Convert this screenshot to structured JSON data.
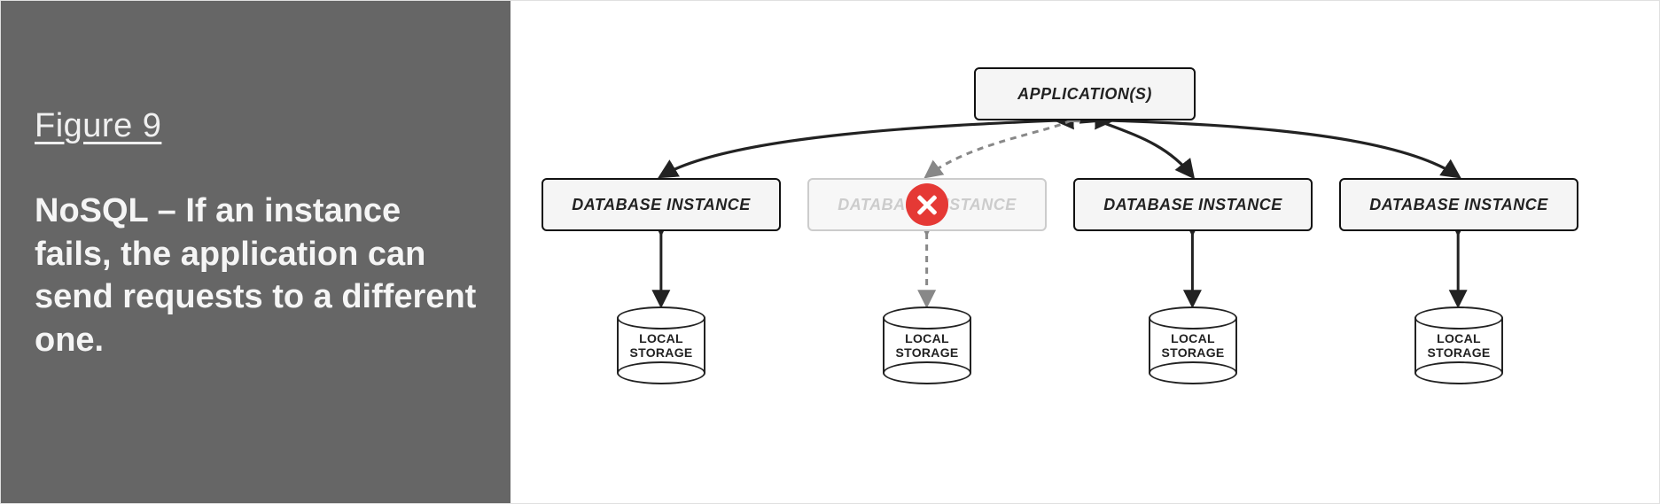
{
  "sidebar": {
    "figure_label": "Figure 9",
    "caption": "NoSQL – If an instance fails, the application can send requests to a different one."
  },
  "diagram": {
    "app": {
      "label": "APPLICATION(S)"
    },
    "instances": [
      {
        "label": "DATABASE INSTANCE",
        "failed": false
      },
      {
        "label": "DATABASE INSTANCE",
        "failed": true
      },
      {
        "label": "DATABASE INSTANCE",
        "failed": false
      },
      {
        "label": "DATABASE INSTANCE",
        "failed": false
      }
    ],
    "storage_label_line1": "LOCAL",
    "storage_label_line2": "STORAGE"
  }
}
